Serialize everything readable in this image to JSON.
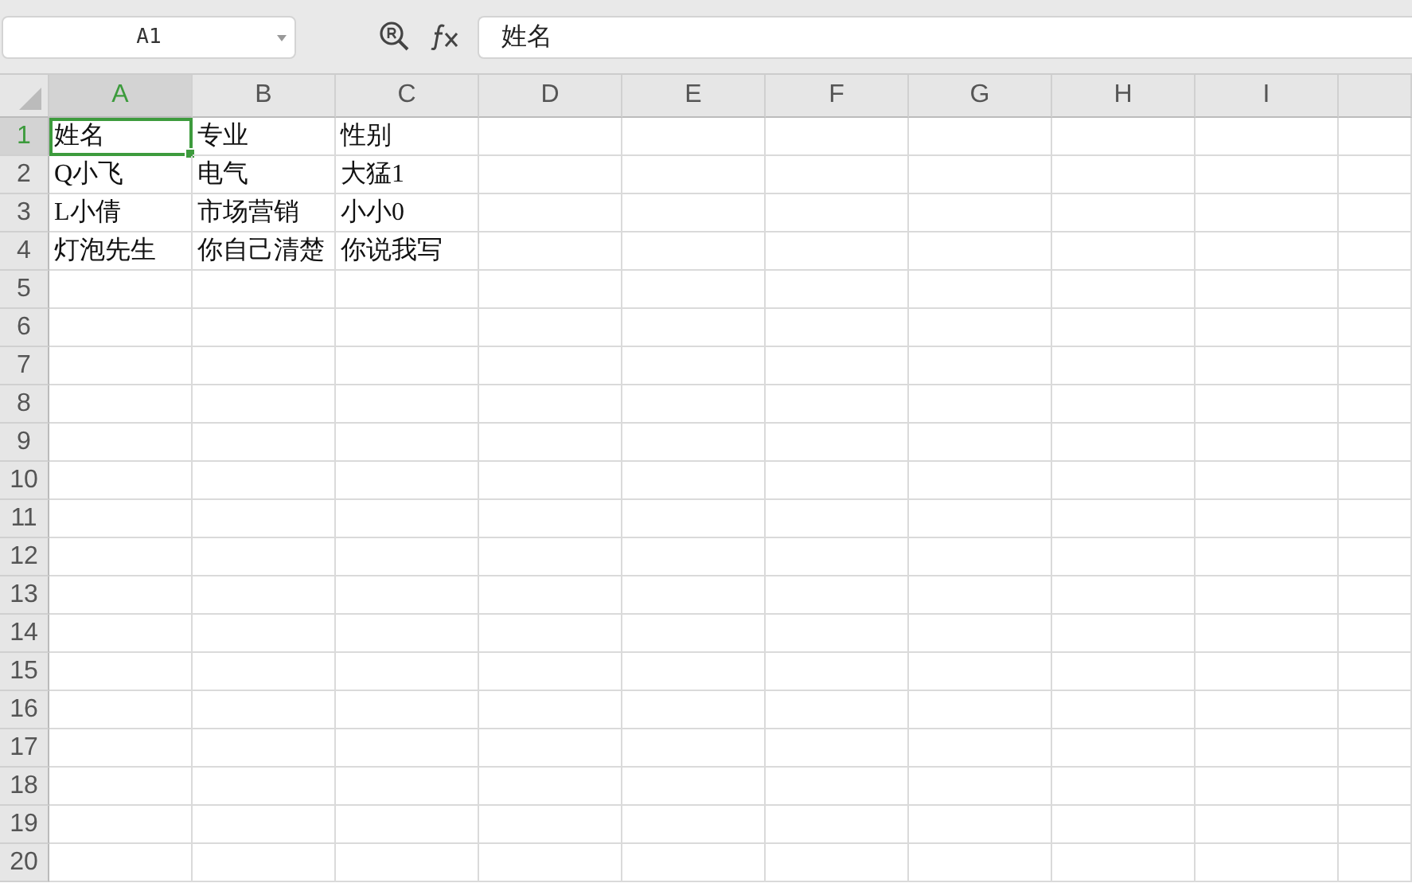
{
  "name_box": {
    "value": "A1"
  },
  "formula_bar": {
    "value": "姓名"
  },
  "columns": [
    {
      "label": "A",
      "selected": true
    },
    {
      "label": "B",
      "selected": false
    },
    {
      "label": "C",
      "selected": false
    },
    {
      "label": "D",
      "selected": false
    },
    {
      "label": "E",
      "selected": false
    },
    {
      "label": "F",
      "selected": false
    },
    {
      "label": "G",
      "selected": false
    },
    {
      "label": "H",
      "selected": false
    },
    {
      "label": "I",
      "selected": false
    }
  ],
  "rows": [
    {
      "number": "1",
      "selected": true,
      "cells": [
        {
          "text": "姓名",
          "selected": true
        },
        {
          "text": "专业",
          "selected": false
        },
        {
          "text": "性别",
          "selected": false
        }
      ]
    },
    {
      "number": "2",
      "selected": false,
      "cells": [
        {
          "text": "Q小飞",
          "selected": false
        },
        {
          "text": "电气",
          "selected": false
        },
        {
          "text": "大猛1",
          "selected": false
        }
      ]
    },
    {
      "number": "3",
      "selected": false,
      "cells": [
        {
          "text": "L小倩",
          "selected": false
        },
        {
          "text": "市场营销",
          "selected": false
        },
        {
          "text": "小小0",
          "selected": false
        }
      ]
    },
    {
      "number": "4",
      "selected": false,
      "cells": [
        {
          "text": "灯泡先生",
          "selected": false
        },
        {
          "text": "你自己清楚",
          "selected": false
        },
        {
          "text": "你说我写",
          "selected": false
        }
      ]
    },
    {
      "number": "5",
      "selected": false
    },
    {
      "number": "6",
      "selected": false
    },
    {
      "number": "7",
      "selected": false
    },
    {
      "number": "8",
      "selected": false
    },
    {
      "number": "9",
      "selected": false
    },
    {
      "number": "10",
      "selected": false
    },
    {
      "number": "11",
      "selected": false
    },
    {
      "number": "12",
      "selected": false
    },
    {
      "number": "13",
      "selected": false
    },
    {
      "number": "14",
      "selected": false
    },
    {
      "number": "15",
      "selected": false
    },
    {
      "number": "16",
      "selected": false
    },
    {
      "number": "17",
      "selected": false
    },
    {
      "number": "18",
      "selected": false
    },
    {
      "number": "19",
      "selected": false
    },
    {
      "number": "20",
      "selected": false
    }
  ]
}
